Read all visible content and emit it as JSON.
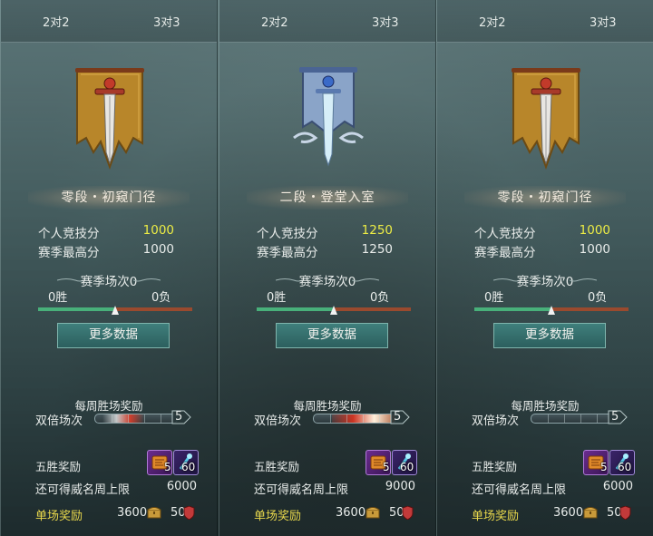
{
  "panels": [
    {
      "tabs": [
        "2对2",
        "3对3"
      ],
      "emblem": "gold-banner-sword-icon",
      "rank": "零段・初窥门径",
      "personal_label": "个人竞技分",
      "personal_value": "1000",
      "season_high_label": "赛季最高分",
      "season_high_value": "1000",
      "season_matches": "赛季场次0",
      "wins": "0胜",
      "losses": "0负",
      "more_button": "更多数据",
      "weekly_reward": "每周胜场奖励",
      "double_label": "双倍场次",
      "double_count": "5",
      "five_win_label": "五胜奖励",
      "item1_count": "5",
      "item2_count": "60",
      "limit_label": "还可得威名周上限",
      "limit_value": "6000",
      "single_label": "单场奖励",
      "single_value1": "3600",
      "single_value2": "50"
    },
    {
      "tabs": [
        "2对2",
        "3对3"
      ],
      "emblem": "silver-banner-sword-icon",
      "rank": "二段・登堂入室",
      "personal_label": "个人竞技分",
      "personal_value": "1250",
      "season_high_label": "赛季最高分",
      "season_high_value": "1250",
      "season_matches": "赛季场次0",
      "wins": "0胜",
      "losses": "0负",
      "more_button": "更多数据",
      "weekly_reward": "每周胜场奖励",
      "double_label": "双倍场次",
      "double_count": "5",
      "five_win_label": "五胜奖励",
      "item1_count": "5",
      "item2_count": "60",
      "limit_label": "还可得威名周上限",
      "limit_value": "9000",
      "single_label": "单场奖励",
      "single_value1": "3600",
      "single_value2": "50"
    },
    {
      "tabs": [
        "2对2",
        "3对3"
      ],
      "emblem": "gold-banner-sword-icon",
      "rank": "零段・初窥门径",
      "personal_label": "个人竞技分",
      "personal_value": "1000",
      "season_high_label": "赛季最高分",
      "season_high_value": "1000",
      "season_matches": "赛季场次0",
      "wins": "0胜",
      "losses": "0负",
      "more_button": "更多数据",
      "weekly_reward": "每周胜场奖励",
      "double_label": "双倍场次",
      "double_count": "5",
      "five_win_label": "五胜奖励",
      "item1_count": "5",
      "item2_count": "60",
      "limit_label": "还可得威名周上限",
      "limit_value": "6000",
      "single_label": "单场奖励",
      "single_value1": "3600",
      "single_value2": "50"
    }
  ],
  "colors": {
    "score_highlight": "#ecec45",
    "single_reward": "#e8d84c",
    "win_bar": "#48b07a",
    "loss_bar": "#9a4a2e"
  },
  "win_ratio": 0.5
}
